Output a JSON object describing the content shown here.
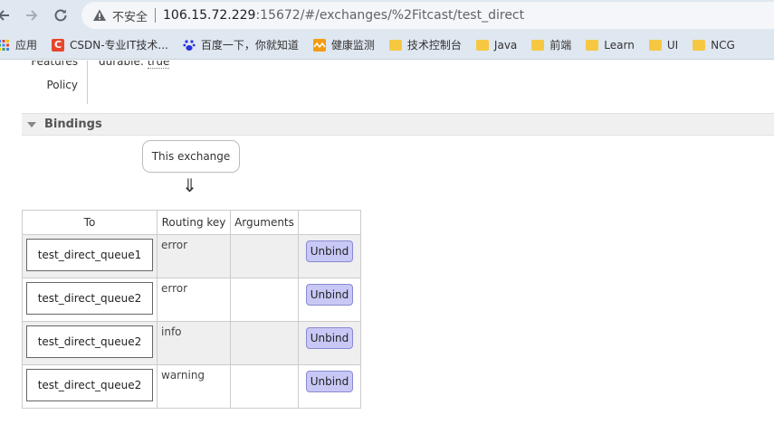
{
  "browser": {
    "security_label": "不安全",
    "url_host": "106.15.72.229",
    "url_rest": ":15672/#/exchanges/%2Fitcast/test_direct",
    "bookmarks": [
      {
        "label": "应用",
        "icon": "apps-grid-icon"
      },
      {
        "label": "CSDN-专业IT技术...",
        "icon": "csdn-logo-icon"
      },
      {
        "label": "百度一下，你就知道",
        "icon": "baidu-paw-icon"
      },
      {
        "label": "健康监测",
        "icon": "health-icon"
      },
      {
        "label": "技术控制台",
        "icon": "folder-icon"
      },
      {
        "label": "Java",
        "icon": "folder-icon"
      },
      {
        "label": "前端",
        "icon": "folder-icon"
      },
      {
        "label": "Learn",
        "icon": "folder-icon"
      },
      {
        "label": "UI",
        "icon": "folder-icon"
      },
      {
        "label": "NCG",
        "icon": "folder-icon"
      }
    ]
  },
  "properties": {
    "features_label": "Features",
    "features_value_key": "durable:",
    "features_value": "true",
    "policy_label": "Policy"
  },
  "bindings": {
    "title": "Bindings",
    "source_label": "This exchange",
    "arrow": "⇓",
    "columns": [
      "To",
      "Routing key",
      "Arguments",
      ""
    ],
    "unbind_label": "Unbind",
    "rows": [
      {
        "to": "test_direct_queue1",
        "routing_key": "error",
        "arguments": ""
      },
      {
        "to": "test_direct_queue2",
        "routing_key": "error",
        "arguments": ""
      },
      {
        "to": "test_direct_queue2",
        "routing_key": "info",
        "arguments": ""
      },
      {
        "to": "test_direct_queue2",
        "routing_key": "warning",
        "arguments": ""
      }
    ]
  },
  "colors": {
    "chrome": "#dfe7f0",
    "unbind_button": "#c8c8f6",
    "row_shade": "#efefef"
  }
}
